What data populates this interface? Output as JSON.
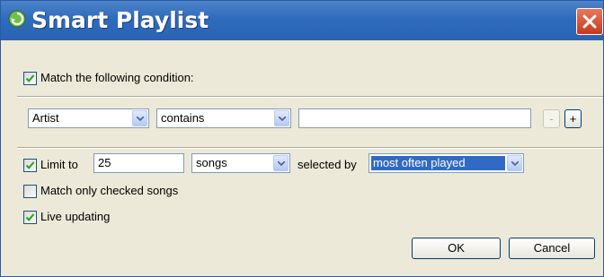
{
  "window": {
    "title": "Smart Playlist",
    "icons": {
      "app": "playlist-icon",
      "close": "close-icon"
    }
  },
  "match_condition": {
    "label": "Match the following condition:",
    "checked": true
  },
  "rule": {
    "field": "Artist",
    "operator": "contains",
    "value": "",
    "remove_label": "-",
    "add_label": "+"
  },
  "limit": {
    "checked": true,
    "label": "Limit to",
    "amount": "25",
    "unit": "songs",
    "selected_by_label": "selected by",
    "selected_by": "most often played"
  },
  "match_checked": {
    "label": "Match only checked songs",
    "checked": false
  },
  "live_updating": {
    "label": "Live updating",
    "checked": true
  },
  "buttons": {
    "ok": "OK",
    "cancel": "Cancel"
  },
  "colors": {
    "title_bar": "#2f6bbd",
    "close_button": "#d14a2b",
    "selection": "#316ac5",
    "check": "#21a121"
  }
}
